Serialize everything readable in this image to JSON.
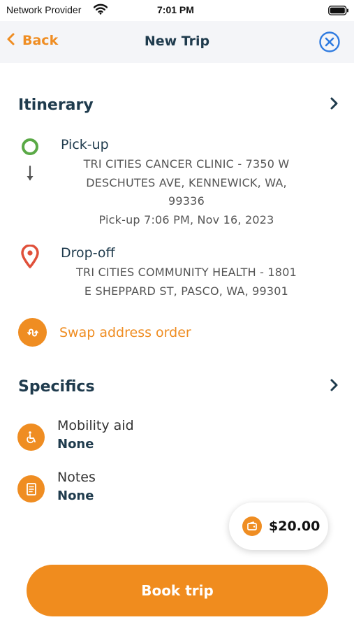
{
  "status_bar": {
    "carrier": "Network Provider",
    "time": "7:01 PM",
    "wifi_icon": "wifi-icon",
    "battery_icon": "battery-icon"
  },
  "nav": {
    "back_label": "Back",
    "title": "New Trip",
    "back_icon": "chevron-left-icon",
    "close_icon": "close-circle-icon"
  },
  "itinerary": {
    "title": "Itinerary",
    "chevron_icon": "chevron-right-icon",
    "pickup": {
      "label": "Pick-up",
      "icon": "pickup-circle-icon",
      "address_lines": [
        "TRI CITIES CANCER CLINIC - 7350 W",
        "DESCHUTES AVE, KENNEWICK, WA,",
        "99336"
      ],
      "time_line": "Pick-up 7:06 PM, Nov 16, 2023"
    },
    "direction_icon": "arrow-down-icon",
    "dropoff": {
      "label": "Drop-off",
      "icon": "map-pin-icon",
      "address_lines": [
        "TRI CITIES COMMUNITY HEALTH - 1801",
        "E SHEPPARD ST, PASCO, WA, 99301"
      ]
    },
    "swap": {
      "label": "Swap address order",
      "icon": "swap-icon"
    }
  },
  "specifics": {
    "title": "Specifics",
    "chevron_icon": "chevron-right-icon",
    "items": [
      {
        "label": "Mobility aid",
        "value": "None",
        "icon": "wheelchair-icon"
      },
      {
        "label": "Notes",
        "value": "None",
        "icon": "notes-icon"
      }
    ]
  },
  "price": {
    "value": "$20.00",
    "icon": "wallet-icon"
  },
  "book_button": {
    "label": "Book trip"
  },
  "colors": {
    "accent": "#ef8d22",
    "primary_text": "#1f3b4d",
    "pickup_green": "#5aa946",
    "dropoff_red": "#e0503a",
    "close_blue": "#2f7be0"
  }
}
